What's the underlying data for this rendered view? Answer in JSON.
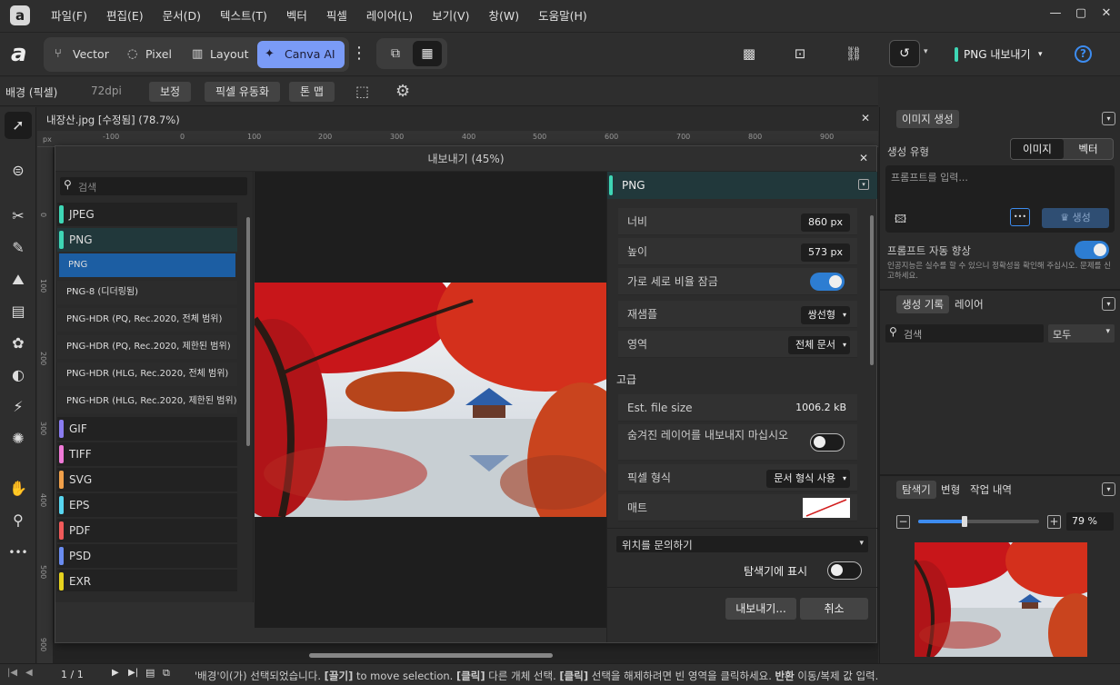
{
  "menu": {
    "items": [
      "파일(F)",
      "편집(E)",
      "문서(D)",
      "텍스트(T)",
      "벡터",
      "픽셀",
      "레이어(L)",
      "보기(V)",
      "창(W)",
      "도움말(H)"
    ]
  },
  "window": {
    "min": "—",
    "max": "▢",
    "close": "✕"
  },
  "personas": {
    "vector": "Vector",
    "pixel": "Pixel",
    "layout": "Layout",
    "canva": "Canva AI"
  },
  "toolbar": {
    "export_label": "PNG 내보내기",
    "help": "?"
  },
  "context": {
    "layer": "배경 (픽셀)",
    "dpi": "72dpi",
    "btn_adjust": "보정",
    "btn_liquify": "픽셀 유동화",
    "btn_tonemap": "톤 맵"
  },
  "document": {
    "tab_title": "내장산.jpg [수정됨] (78.7%)",
    "ruler_unit": "px",
    "ruler_top": [
      "-100",
      "0",
      "100",
      "200",
      "300",
      "400",
      "500",
      "600",
      "700",
      "800",
      "900"
    ],
    "ruler_left": [
      "0",
      "100",
      "200",
      "300",
      "400",
      "500",
      "900"
    ]
  },
  "dialog": {
    "title": "내보내기 (45%)",
    "search_placeholder": "검색",
    "formats": [
      {
        "label": "JPEG",
        "color": "#3ed6b5"
      },
      {
        "label": "PNG",
        "color": "#3ed6b5"
      },
      {
        "label": "GIF",
        "color": "#8a7cf0"
      },
      {
        "label": "TIFF",
        "color": "#f07ad8"
      },
      {
        "label": "SVG",
        "color": "#f0a04a"
      },
      {
        "label": "EPS",
        "color": "#58d6f0"
      },
      {
        "label": "PDF",
        "color": "#f05a5a"
      },
      {
        "label": "PSD",
        "color": "#6a8cf0"
      },
      {
        "label": "EXR",
        "color": "#e6d21e"
      }
    ],
    "presets": [
      "PNG",
      "PNG-8 (디더링됨)",
      "PNG-HDR (PQ, Rec.2020, 전체 범위)",
      "PNG-HDR (PQ, Rec.2020, 제한된 범위)",
      "PNG-HDR (HLG, Rec.2020, 전체 범위)",
      "PNG-HDR (HLG, Rec.2020, 제한된 범위)"
    ],
    "options": {
      "header": "PNG",
      "width_label": "너비",
      "width_value": "860 px",
      "height_label": "높이",
      "height_value": "573 px",
      "lock_label": "가로 세로 비율 잠금",
      "lock_on": true,
      "resample_label": "재샘플",
      "resample_value": "쌍선형",
      "area_label": "영역",
      "area_value": "전체 문서",
      "advanced_label": "고급",
      "filesize_label": "Est. file size",
      "filesize_value": "1006.2 kB",
      "hidden_label": "숨겨진 레이어를 내보내지 마십시오",
      "hidden_on": false,
      "pixel_format_label": "픽셀 형식",
      "pixel_format_value": "문서 형식 사용",
      "matte_label": "매트",
      "location_value": "위치를 문의하기",
      "show_in_explorer_label": "탐색기에 표시",
      "show_in_explorer_on": false,
      "export_button": "내보내기...",
      "cancel_button": "취소"
    }
  },
  "right": {
    "imagegen": {
      "tab": "이미지 생성",
      "type_label": "생성 유형",
      "type_image": "이미지",
      "type_vector": "벡터",
      "prompt_placeholder": "프롬프트를 입력...",
      "more": "•••",
      "generate": "생성",
      "enhance_label": "프롬프트 자동 향상",
      "enhance_on": true,
      "disclaimer": "인공지능은 실수를 할 수 있으니 정확성을 확인해 주십시오. 문제를 신고하세요."
    },
    "history": {
      "tab_history": "생성 기록",
      "tab_layers": "레이어",
      "search_placeholder": "검색",
      "filter_value": "모두"
    },
    "navigator": {
      "tab_nav": "탐색기",
      "tab_transform": "변형",
      "tab_history": "작업 내역",
      "zoom_value": "79 %",
      "zoom_fraction": 0.38
    }
  },
  "status": {
    "page": "1 / 1",
    "message_prefix": "'배경'이(가) 선택되었습니다. ",
    "drag": "[끌기]",
    "msg1": " to move selection. ",
    "click1": "[클릭]",
    "msg2": " 다른 개체 선택. ",
    "click2": "[클릭]",
    "msg3": " 선택을 해제하려면 빈 영역을 클릭하세요. ",
    "invert": "반환",
    "msg4": " 이동/복제 값 입력."
  },
  "colors": {
    "accent": "#2d7dd2",
    "canva": "#7a9bf7",
    "teal": "#3ed6b5"
  }
}
